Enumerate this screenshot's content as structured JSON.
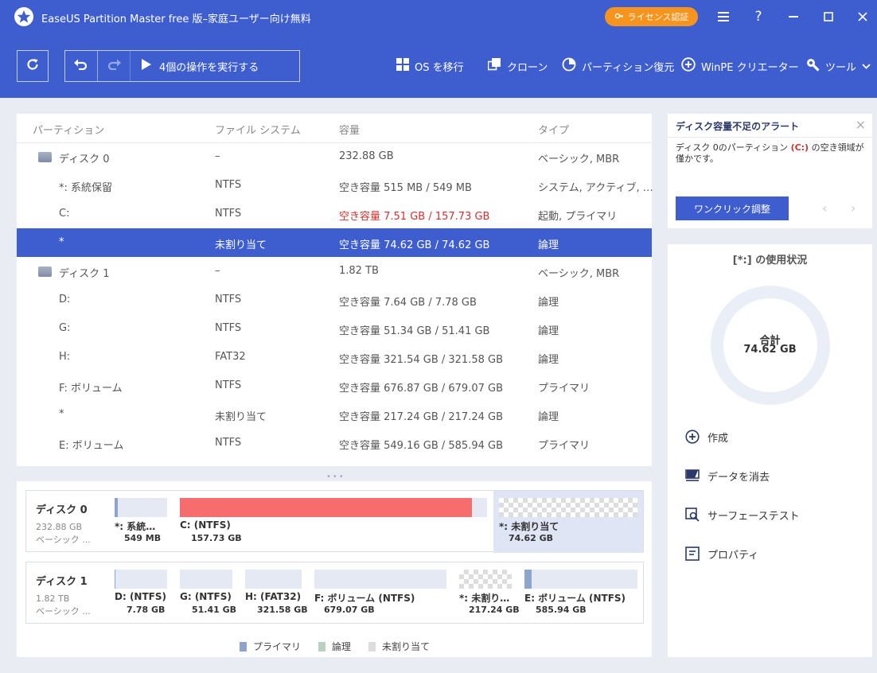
{
  "titlebar": {
    "title": "EaseUS Partition Master free 版–家庭ユーザー向け無料",
    "license_label": "ライセンス認証"
  },
  "toolbar": {
    "execute_label": "4個の操作を実行する",
    "tools": [
      {
        "label": "OS を移行",
        "icon": "windows-icon"
      },
      {
        "label": "クローン",
        "icon": "clone-icon"
      },
      {
        "label": "パーティション復元",
        "icon": "pie-icon"
      },
      {
        "label": "WinPE クリエーター",
        "icon": "plus-circle-icon"
      },
      {
        "label": "ツール",
        "icon": "wrench-icon"
      }
    ]
  },
  "table": {
    "headers": [
      "パーティション",
      "ファイル システム",
      "容量",
      "タイプ"
    ],
    "rows": [
      {
        "name": "ディスク 0",
        "fs": "–",
        "capacity": "232.88 GB",
        "type": "ベーシック, MBR",
        "disk": true
      },
      {
        "name": "*: 系統保留",
        "fs": "NTFS",
        "capacity": "空き容量 515 MB / 549 MB",
        "type": "システム, アクティブ, …"
      },
      {
        "name": "C:",
        "fs": "NTFS",
        "capacity": "空き容量 7.51 GB / 157.73 GB",
        "type": "起動, プライマリ",
        "warn": true
      },
      {
        "name": "*",
        "fs": "未割り当て",
        "capacity": "空き容量 74.62 GB / 74.62 GB",
        "type": "論理",
        "selected": true
      },
      {
        "name": "ディスク 1",
        "fs": "–",
        "capacity": "1.82 TB",
        "type": "ベーシック, MBR",
        "disk": true
      },
      {
        "name": "D:",
        "fs": "NTFS",
        "capacity": "空き容量 7.64 GB / 7.78 GB",
        "type": "論理"
      },
      {
        "name": "G:",
        "fs": "NTFS",
        "capacity": "空き容量 51.34 GB / 51.41 GB",
        "type": "論理"
      },
      {
        "name": "H:",
        "fs": "FAT32",
        "capacity": "空き容量 321.54 GB / 321.58 GB",
        "type": "論理"
      },
      {
        "name": "F: ボリューム",
        "fs": "NTFS",
        "capacity": "空き容量 676.87 GB / 679.07 GB",
        "type": "プライマリ"
      },
      {
        "name": "*",
        "fs": "未割り当て",
        "capacity": "空き容量 217.24 GB / 217.24 GB",
        "type": "論理"
      },
      {
        "name": "E: ボリューム",
        "fs": "NTFS",
        "capacity": "空き容量 549.16 GB / 585.94 GB",
        "type": "プライマリ"
      }
    ]
  },
  "diskmap": {
    "disks": [
      {
        "name": "ディスク 0",
        "size": "232.88 GB",
        "type": "ベーシック ...",
        "segments": [
          {
            "label": "*: 系統…",
            "size": "549 MB",
            "used_fraction": 0.06,
            "kind": "primary"
          },
          {
            "label": "C: (NTFS)",
            "size": "157.73 GB",
            "used_fraction": 0.95,
            "kind": "warn"
          },
          {
            "label": "*: 未割り当て",
            "size": "74.62 GB",
            "used_fraction": 0,
            "kind": "unalloc",
            "selected": true
          }
        ]
      },
      {
        "name": "ディスク 1",
        "size": "1.82 TB",
        "type": "ベーシック ...",
        "segments": [
          {
            "label": "D: (NTFS)",
            "size": "7.78 GB",
            "used_fraction": 0.02,
            "kind": "logical"
          },
          {
            "label": "G: (NTFS)",
            "size": "51.41 GB",
            "used_fraction": 0,
            "kind": "logical"
          },
          {
            "label": "H: (FAT32)",
            "size": "321.58 GB",
            "used_fraction": 0,
            "kind": "logical"
          },
          {
            "label": "F: ボリューム (NTFS)",
            "size": "679.07 GB",
            "used_fraction": 0,
            "kind": "primary"
          },
          {
            "label": "*: 未割り…",
            "size": "217.24 GB",
            "used_fraction": 0,
            "kind": "unalloc"
          },
          {
            "label": "E: ボリューム (NTFS)",
            "size": "585.94 GB",
            "used_fraction": 0.06,
            "kind": "primary"
          }
        ]
      }
    ],
    "legend": [
      {
        "label": "プライマリ",
        "color": "#8fa4cc"
      },
      {
        "label": "論理",
        "color": "#b9d2c0"
      },
      {
        "label": "未割り当て",
        "color": "#dddddd"
      }
    ]
  },
  "alert": {
    "title": "ディスク容量不足のアラート",
    "text_before": "ディスク 0のパーティション ",
    "drive": "(C:)",
    "text_after": " の空き領域が僅かです。",
    "button": "ワンクリック調整"
  },
  "usage": {
    "title": "[*:] の使用状況",
    "total_label": "合計",
    "total_value": "74.62 GB",
    "actions": [
      {
        "label": "作成",
        "icon": "plus-circle-icon"
      },
      {
        "label": "データを消去",
        "icon": "eraser-icon"
      },
      {
        "label": "サーフェーステスト",
        "icon": "surface-test-icon"
      },
      {
        "label": "プロパティ",
        "icon": "properties-icon"
      }
    ]
  },
  "colors": {
    "accent": "#3e5ed0",
    "license": "#f7941d",
    "warn": "#f76d6d",
    "warn_text": "#d0312d"
  }
}
